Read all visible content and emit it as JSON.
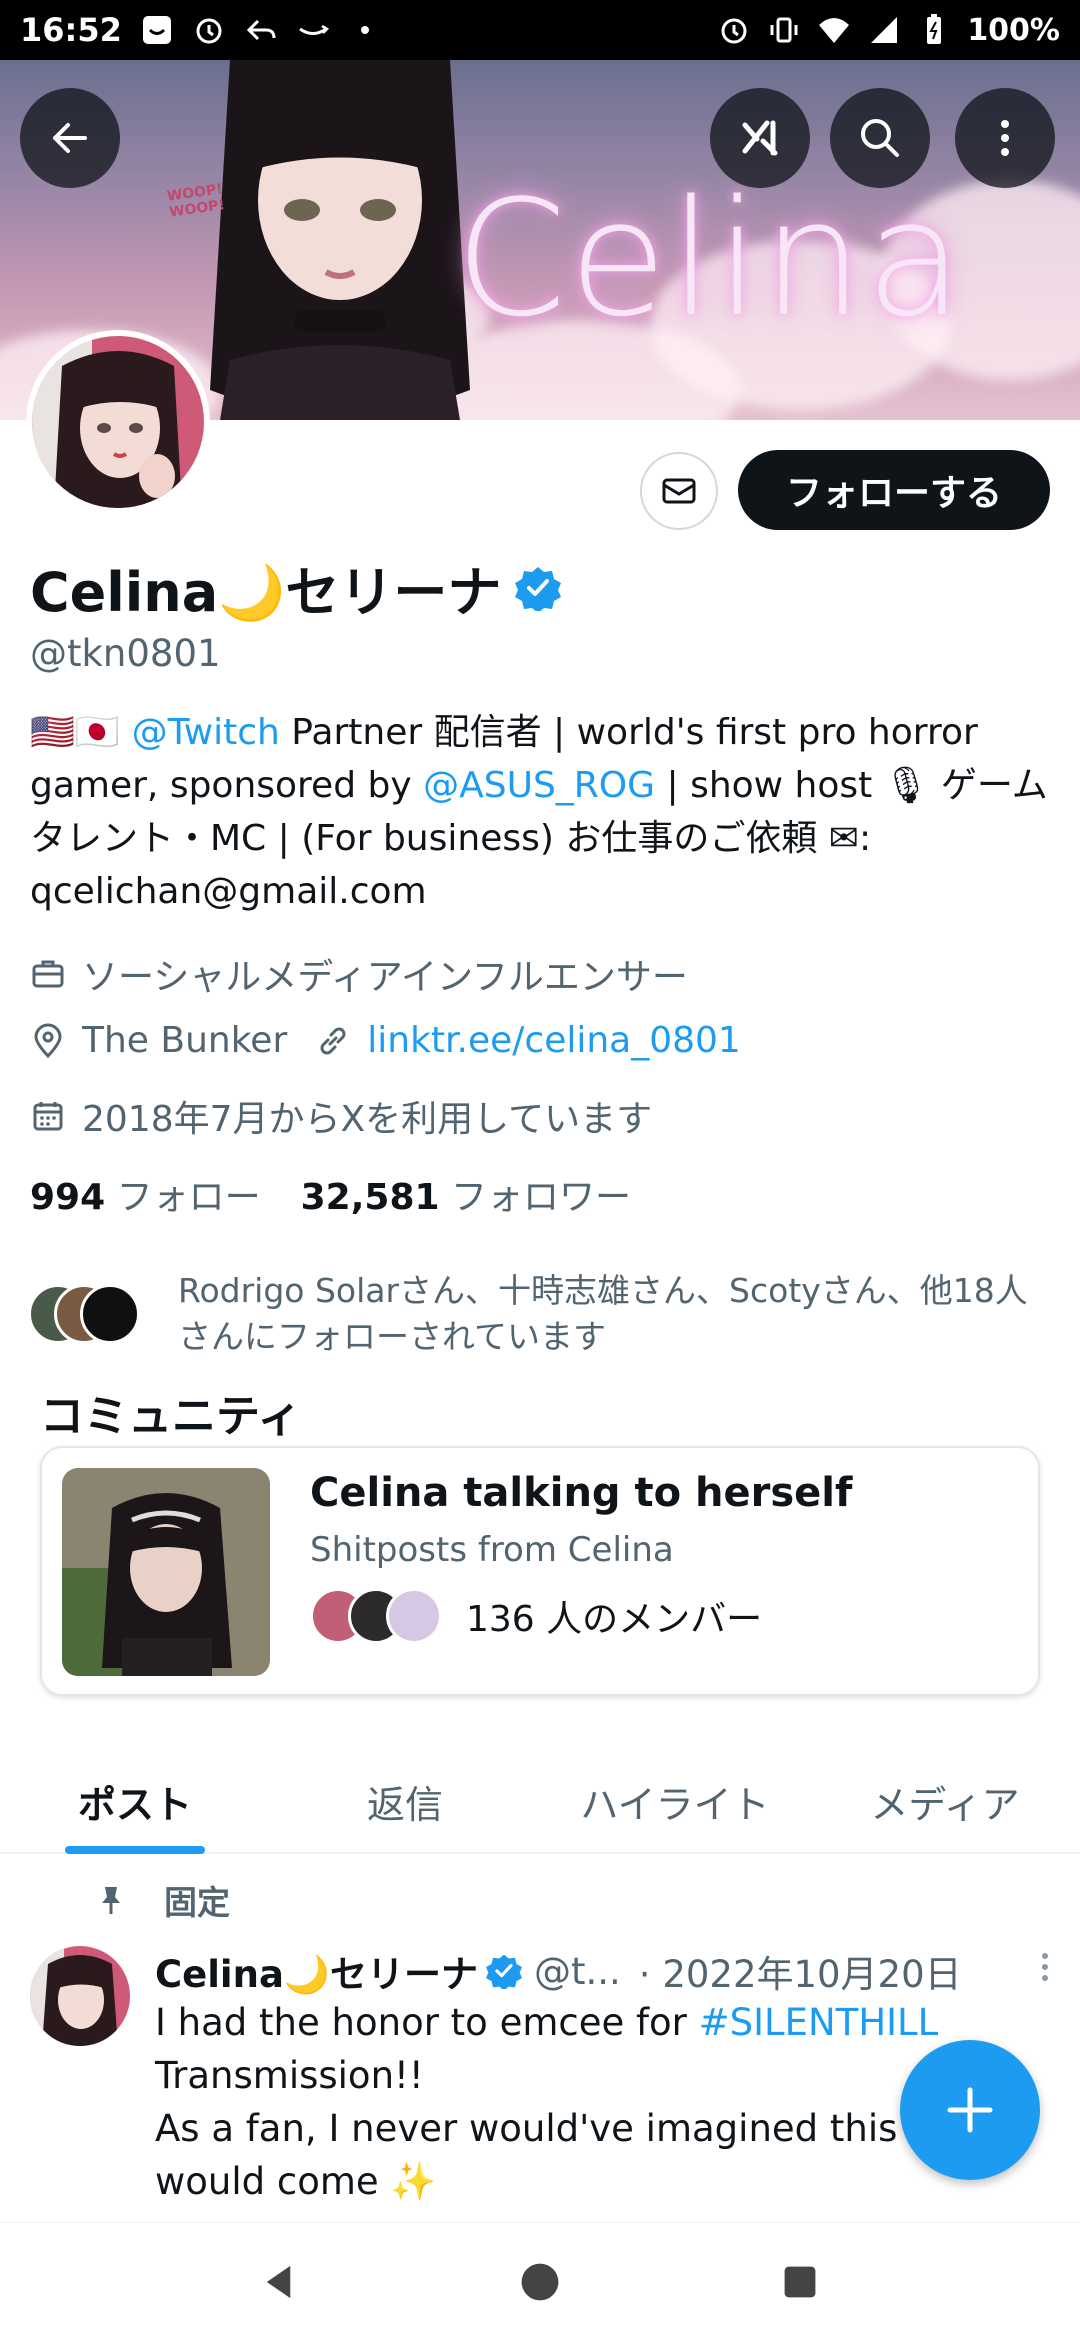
{
  "status_bar": {
    "time": "16:52",
    "battery": "100%"
  },
  "header": {
    "banner_title": "Celina",
    "banner_sign": [
      "WOOP!",
      "WOOP!"
    ]
  },
  "profile": {
    "name": "Celina🌙セリーナ",
    "handle": "@tkn0801",
    "follow_label": "フォローする",
    "bio": {
      "flags": "🇺🇸🇯🇵",
      "mention_twitch": "@Twitch",
      "text1": " Partner 配信者 | world's first pro horror gamer, sponsored by ",
      "mention_asus": "@ASUS_ROG",
      "text2": " | show host 🎙 ゲームタレント・MC | (For business) お仕事のご依頼 ✉:",
      "email": "qcelichan@gmail.com"
    },
    "category": "ソーシャルメディアインフルエンサー",
    "location": "The Bunker",
    "website": "linktr.ee/celina_0801",
    "joined": "2018年7月からXを利用しています",
    "following_count": "994",
    "following_label": "フォロー",
    "followers_count": "32,581",
    "followers_label": "フォロワー",
    "followed_by": "Rodrigo Solarさん、十時志雄さん、Scotyさん、他18人さんにフォローされています"
  },
  "community": {
    "section_title": "コミュニティ",
    "name": "Celina talking to herself",
    "description": "Shitposts from Celina",
    "members": "136 人のメンバー"
  },
  "tabs": [
    "ポスト",
    "返信",
    "ハイライト",
    "メディア"
  ],
  "pinned_tweet": {
    "pinned_label": "固定",
    "author": "Celina🌙セリーナ",
    "handle": "@t...",
    "date": "· 2022年10月20日",
    "line1_pre": "I had the honor to emcee for ",
    "hashtag": "#SILENTHILL",
    "line2": "Transmission!!",
    "line3": "As a fan, I never would've imagined this d",
    "line4": "would come ✨"
  },
  "colors": {
    "accent": "#1d9bf0",
    "text": "#0f1419",
    "secondary": "#536471"
  }
}
